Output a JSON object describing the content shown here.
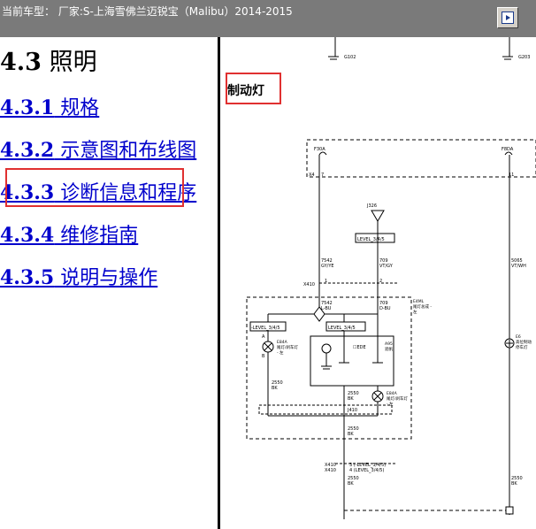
{
  "header": {
    "vehicle_info": "当前车型： 厂家:S-上海雪佛兰迈锐宝（Malibu）2014-2015"
  },
  "toc": {
    "section_title_num": "4.3",
    "section_title_text": " 照明",
    "items": [
      {
        "num": "4.3.1",
        "label": " 规格"
      },
      {
        "num": "4.3.2",
        "label": " 示意图和布线图"
      },
      {
        "num": "4.3.3",
        "label": " 诊断信息和程序"
      },
      {
        "num": "4.3.4",
        "label": " 维修指南"
      },
      {
        "num": "4.3.5",
        "label": " 说明与操作"
      }
    ]
  },
  "diagram": {
    "title": "制动灯",
    "labels": {
      "g102": "G102",
      "g203": "G203",
      "f30a": "F30A",
      "f8da": "F8DA",
      "x4": "X4",
      "pin7": "7",
      "pin11": "11",
      "j326": "J326",
      "level_top": "LEVEL_3/4/5",
      "w7542": "7542",
      "gy_ye": "GY/YE",
      "w709": "709",
      "vt_gy": "VT/GY",
      "w5065": "5065",
      "vt_wh": "VT/WH",
      "x410": "X410",
      "pin1": "1",
      "pin2": "2",
      "e4ml": "E4ML",
      "ldeng": "尾灯总成 -",
      "zuo": "左",
      "w7542b": "7542",
      "l_bu": "L-BU",
      "w709b": "709",
      "d_bu": "D-BU",
      "level_left": "-LEVEL_3/4/5",
      "level_right": "LEVEL_3/4/5",
      "e84a": "E84A",
      "tail_l": "尾灯/刹车灯",
      "tail_l2": "- 左",
      "pa": "A",
      "pb": "B",
      "a95": "A95",
      "a95b": "遮帆",
      "e84a2": "E84A",
      "tail_r": "尾灯/刹车灯",
      "tail_r2": "- 左",
      "w2550": "2550",
      "bk": "BK",
      "j410": "J410",
      "w2550b": "2550",
      "bkb": "BK",
      "w2550c": "2550",
      "bkc": "BK",
      "x410b": "X410",
      "x410c": "X410",
      "pin3": "3 (-LEVEL_3/4/5)",
      "pin4": "4 (LEVEL_3/4/5)",
      "w2550d": "2550",
      "bkd": "BK",
      "w2550e": "2550",
      "bke": "BK",
      "e6": "E6",
      "e6t": "高位制动",
      "e6t2": "停车灯"
    }
  }
}
